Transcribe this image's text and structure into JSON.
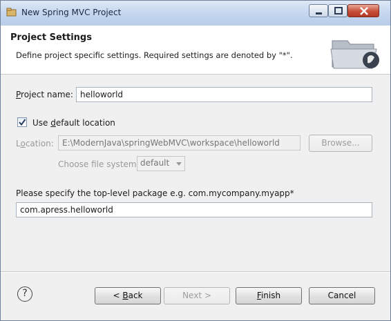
{
  "window": {
    "title": "New Spring MVC Project"
  },
  "header": {
    "title": "Project Settings",
    "description": "Define project specific settings. Required settings are denoted by \"*\"."
  },
  "form": {
    "project_name_label_pre": "",
    "project_name_label_ul": "P",
    "project_name_label_post": "roject name:",
    "project_name_value": "helloworld",
    "use_default_pre": "Use ",
    "use_default_ul": "d",
    "use_default_post": "efault location",
    "use_default_checked": true,
    "location_label_pre": "L",
    "location_label_ul": "o",
    "location_label_post": "cation:",
    "location_value": "E:\\ModernJava\\springWebMVC\\workspace\\helloworld",
    "browse_label": "Browse...",
    "file_system_label": "Choose file system:",
    "file_system_value": "default",
    "package_prompt": "Please specify the top-level package e.g. com.mycompany.myapp*",
    "package_value": "com.apress.helloworld"
  },
  "footer": {
    "help_glyph": "?",
    "back_pre": "< ",
    "back_ul": "B",
    "back_post": "ack",
    "next_label": "Next >",
    "finish_ul": "F",
    "finish_post": "inish",
    "cancel_label": "Cancel"
  }
}
